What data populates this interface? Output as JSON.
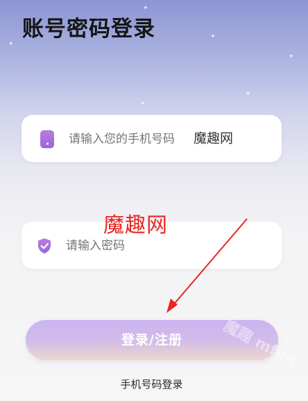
{
  "page": {
    "title": "账号密码登录"
  },
  "phone_field": {
    "placeholder": "请输入您的手机号码",
    "icon": "phone-icon"
  },
  "password_field": {
    "placeholder": "请输入密码",
    "icon": "shield-icon"
  },
  "watermark": {
    "inline": "魔趣网",
    "red": "魔趣网",
    "diagonal": "魔趣 mfun"
  },
  "login_button": {
    "label": "登录/注册"
  },
  "alt_login": {
    "label": "手机号码登录"
  },
  "colors": {
    "accent_start": "#cbb3f0",
    "accent_end": "#ecd7c9",
    "icon_purple": "#9a66d6",
    "arrow_red": "#e8261f"
  }
}
